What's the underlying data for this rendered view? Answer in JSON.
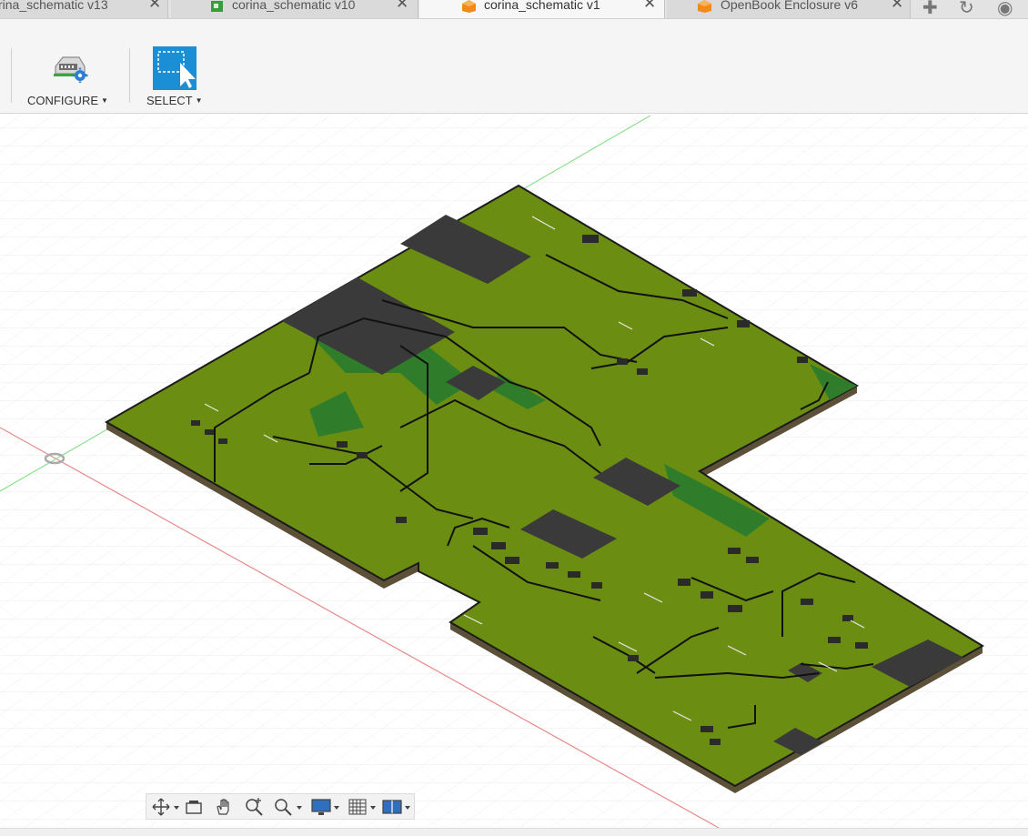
{
  "tabs": [
    {
      "label": "rina_schematic v13",
      "active": false
    },
    {
      "label": "corina_schematic v10",
      "active": false
    },
    {
      "label": "corina_schematic v1",
      "active": true
    },
    {
      "label": "OpenBook Enclosure v6",
      "active": false
    }
  ],
  "toolbar": {
    "configure_label": "CONFIGURE",
    "select_label": "SELECT"
  },
  "icons": {
    "close": "close-icon",
    "new_tab": "plus-icon",
    "refresh": "refresh-icon",
    "account": "account-icon",
    "configure": "configure-gear-icon",
    "select": "select-cursor-icon"
  },
  "nav_bar": [
    "orbit-icon",
    "look-at-icon",
    "pan-icon",
    "zoom-icon",
    "zoom-window-icon",
    "display-settings-icon",
    "grid-settings-icon",
    "viewports-icon"
  ],
  "colors": {
    "board_top": "#6b8e12",
    "board_dark_green": "#2f7d2a",
    "board_edge": "#5c5138",
    "component": "#3a3a3a",
    "select_blue": "#1a8fd6",
    "axis_red": "#e78a8a",
    "axis_green": "#8fe08f"
  }
}
